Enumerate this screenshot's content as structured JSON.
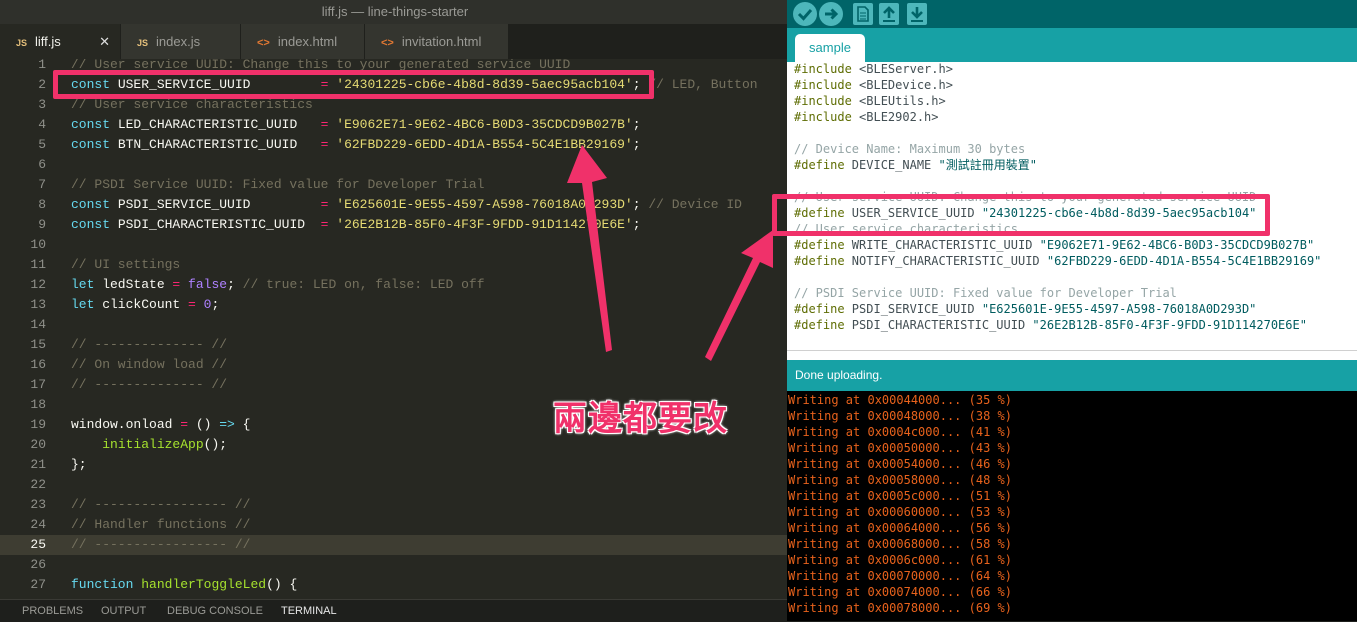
{
  "window": {
    "title": "liff.js — line-things-starter"
  },
  "tabs": [
    {
      "label": "liff.js",
      "icon": "JS",
      "active": true
    },
    {
      "label": "index.js",
      "icon": "JS",
      "active": false
    },
    {
      "label": "index.html",
      "icon": "<>",
      "active": false
    },
    {
      "label": "invitation.html",
      "icon": "<>",
      "active": false
    }
  ],
  "editor": {
    "current_line": 25,
    "lines": [
      {
        "n": "1",
        "t": "// User service UUID: Change this to your generated service UUID"
      },
      {
        "n": "2",
        "t": "const USER_SERVICE_UUID         = '24301225-cb6e-4b8d-8d39-5aec95acb104'; // LED, Button"
      },
      {
        "n": "3",
        "t": "// User service characteristics"
      },
      {
        "n": "4",
        "t": "const LED_CHARACTERISTIC_UUID   = 'E9062E71-9E62-4BC6-B0D3-35CDCD9B027B';"
      },
      {
        "n": "5",
        "t": "const BTN_CHARACTERISTIC_UUID   = '62FBD229-6EDD-4D1A-B554-5C4E1BB29169';"
      },
      {
        "n": "6",
        "t": ""
      },
      {
        "n": "7",
        "t": "// PSDI Service UUID: Fixed value for Developer Trial"
      },
      {
        "n": "8",
        "t": "const PSDI_SERVICE_UUID         = 'E625601E-9E55-4597-A598-76018A0D293D'; // Device ID"
      },
      {
        "n": "9",
        "t": "const PSDI_CHARACTERISTIC_UUID  = '26E2B12B-85F0-4F3F-9FDD-91D114270E6E';"
      },
      {
        "n": "10",
        "t": ""
      },
      {
        "n": "11",
        "t": "// UI settings"
      },
      {
        "n": "12",
        "t": "let ledState = false; // true: LED on, false: LED off"
      },
      {
        "n": "13",
        "t": "let clickCount = 0;"
      },
      {
        "n": "14",
        "t": ""
      },
      {
        "n": "15",
        "t": "// -------------- //"
      },
      {
        "n": "16",
        "t": "// On window load //"
      },
      {
        "n": "17",
        "t": "// -------------- //"
      },
      {
        "n": "18",
        "t": ""
      },
      {
        "n": "19",
        "t": "window.onload = () => {"
      },
      {
        "n": "20",
        "t": "    initializeApp();"
      },
      {
        "n": "21",
        "t": "};"
      },
      {
        "n": "22",
        "t": ""
      },
      {
        "n": "23",
        "t": "// ----------------- //"
      },
      {
        "n": "24",
        "t": "// Handler functions //"
      },
      {
        "n": "25",
        "t": "// ----------------- //"
      },
      {
        "n": "26",
        "t": ""
      },
      {
        "n": "27",
        "t": "function handlerToggleLed() {"
      }
    ]
  },
  "panel_tabs": [
    {
      "label": "PROBLEMS",
      "active": false
    },
    {
      "label": "OUTPUT",
      "active": false
    },
    {
      "label": "DEBUG CONSOLE",
      "active": false
    },
    {
      "label": "TERMINAL",
      "active": true
    }
  ],
  "arduino": {
    "toolbar": [
      "verify-icon",
      "upload-icon",
      "new-icon",
      "open-icon",
      "save-icon"
    ],
    "sketch_tab": "sample",
    "code_lines": [
      "#include <BLEServer.h>",
      "#include <BLEDevice.h>",
      "#include <BLEUtils.h>",
      "#include <BLE2902.h>",
      "",
      "// Device Name: Maximum 30 bytes",
      "#define DEVICE_NAME \"測試註冊用裝置\"",
      "",
      "// User service UUID: Change this to your generated service UUID",
      "#define USER_SERVICE_UUID \"24301225-cb6e-4b8d-8d39-5aec95acb104\"",
      "// User service characteristics",
      "#define WRITE_CHARACTERISTIC_UUID \"E9062E71-9E62-4BC6-B0D3-35CDCD9B027B\"",
      "#define NOTIFY_CHARACTERISTIC_UUID \"62FBD229-6EDD-4D1A-B554-5C4E1BB29169\"",
      "",
      "// PSDI Service UUID: Fixed value for Developer Trial",
      "#define PSDI_SERVICE_UUID \"E625601E-9E55-4597-A598-76018A0D293D\"",
      "#define PSDI_CHARACTERISTIC_UUID \"26E2B12B-85F0-4F3F-9FDD-91D114270E6E\""
    ],
    "status": "Done uploading.",
    "console_lines": [
      "Writing at 0x00044000... (35 %)",
      "Writing at 0x00048000... (38 %)",
      "Writing at 0x0004c000... (41 %)",
      "Writing at 0x00050000... (43 %)",
      "Writing at 0x00054000... (46 %)",
      "Writing at 0x00058000... (48 %)",
      "Writing at 0x0005c000... (51 %)",
      "Writing at 0x00060000... (53 %)",
      "Writing at 0x00064000... (56 %)",
      "Writing at 0x00068000... (58 %)",
      "Writing at 0x0006c000... (61 %)",
      "Writing at 0x00070000... (64 %)",
      "Writing at 0x00074000... (66 %)",
      "Writing at 0x00078000... (69 %)"
    ]
  },
  "annotation": {
    "text": "兩邊都要改",
    "color": "#f0316a"
  }
}
